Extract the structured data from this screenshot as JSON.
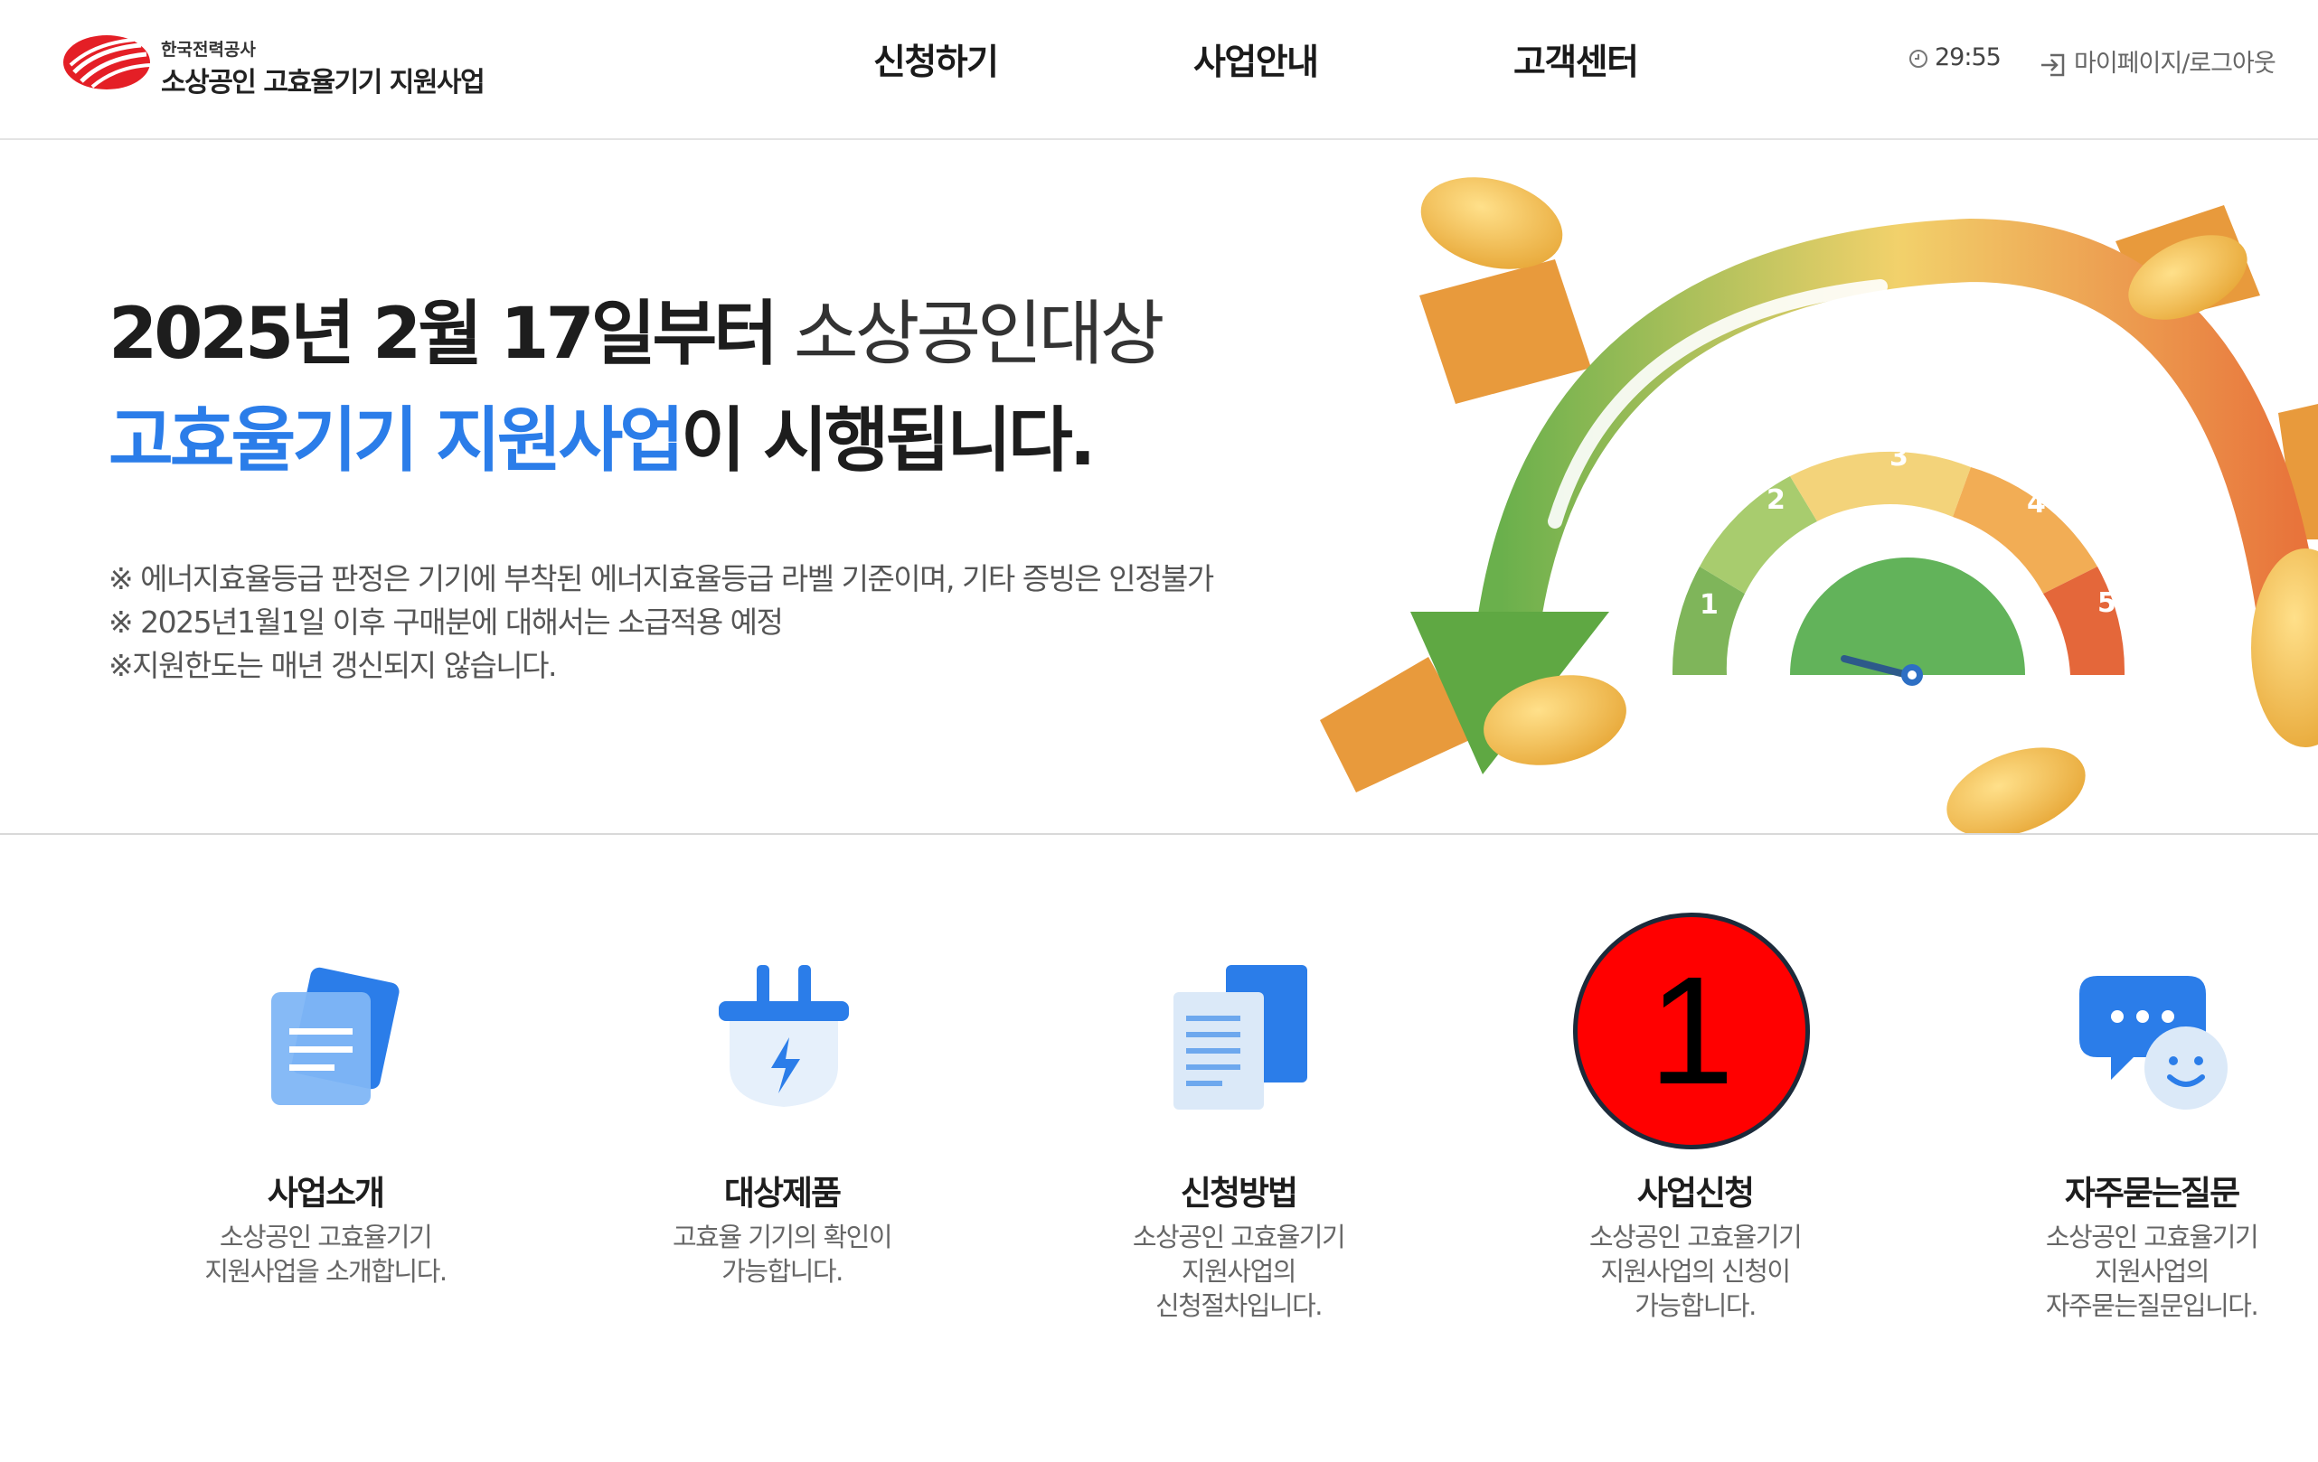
{
  "header": {
    "logo": {
      "org": "한국전력공사",
      "name": "소상공인 고효율기기 지원사업",
      "brand_color": "#e41f26"
    },
    "nav": [
      {
        "label": "신청하기"
      },
      {
        "label": "사업안내"
      },
      {
        "label": "고객센터"
      }
    ],
    "session_timer": "29:55",
    "mypage_login": "마이페이지/로그아웃",
    "icons": {
      "timer": "clock-icon",
      "login": "login-icon"
    }
  },
  "hero": {
    "headline_date": "2025년 2월 17일부터",
    "headline_target": " 소상공인대상",
    "headline_program": "고효율기기 지원사업",
    "headline_suffix": "이 시행됩니다.",
    "notes": [
      "※ 에너지효율등급 판정은 기기에 부착된 에너지효율등급 라벨 기준이며, 기타 증빙은 인정불가",
      "※ 2025년1월1일 이후 구매분에 대해서는 소급적용 예정",
      "※지원한도는 매년 갱신되지 않습니다."
    ],
    "gauge_levels": [
      "1",
      "2",
      "3",
      "4",
      "5"
    ],
    "accent_color": "#2b7de9"
  },
  "quick_menu": [
    {
      "title": "사업소개",
      "desc": [
        "소상공인 고효율기기",
        "지원사업을 소개합니다."
      ],
      "icon": "document-icon"
    },
    {
      "title": "대상제품",
      "desc": [
        "고효율 기기의 확인이",
        "가능합니다."
      ],
      "icon": "plug-icon"
    },
    {
      "title": "신청방법",
      "desc": [
        "소상공인 고효율기기",
        "지원사업의",
        "신청절차입니다."
      ],
      "icon": "file-list-icon"
    },
    {
      "title": "사업신청",
      "desc": [
        "소상공인 고효율기기",
        "지원사업의 신청이",
        "가능합니다."
      ],
      "icon": "apply-icon"
    },
    {
      "title": "자주묻는질문",
      "desc": [
        "소상공인 고효율기기",
        "지원사업의",
        "자주묻는질문입니다."
      ],
      "icon": "chat-icon"
    }
  ],
  "annotation_badge": "1"
}
